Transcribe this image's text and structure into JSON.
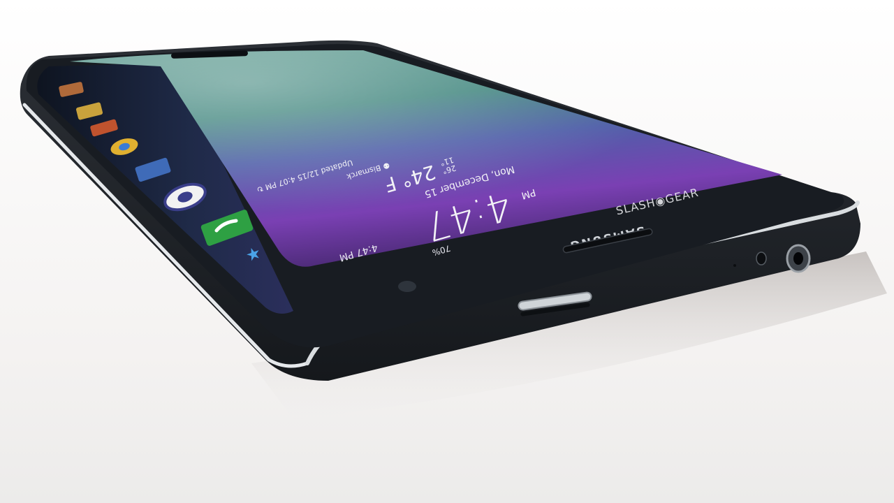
{
  "photo": {
    "brand": "SAMSUNG",
    "watermark": "SLASH◉GEAR",
    "screen": {
      "time": "4:47",
      "ampm": "PM",
      "date": "Mon, December 15",
      "temperature": "24° F",
      "temp_high": "26°",
      "temp_low": "11°",
      "location": "⚉ Bismarck",
      "updated": "Updated 12/15 4:07 PM ↻",
      "status_time": "4:47 PM",
      "battery": "70%"
    }
  },
  "colors": {
    "background": "#f3f2f1",
    "body": "#262a2e",
    "bezel": "#1a1e24",
    "chrome": "#d9dde0",
    "screen_teal": "#4a8c88",
    "screen_purple": "#7a3fb0",
    "phone_icon_green": "#2ea043",
    "star_blue": "#4aa3e8"
  },
  "icons": [
    "phone-icon",
    "camera-icon",
    "gallery-icon",
    "chrome-icon",
    "star-icon",
    "sim-tray-icon",
    "headphone-jack-icon"
  ]
}
